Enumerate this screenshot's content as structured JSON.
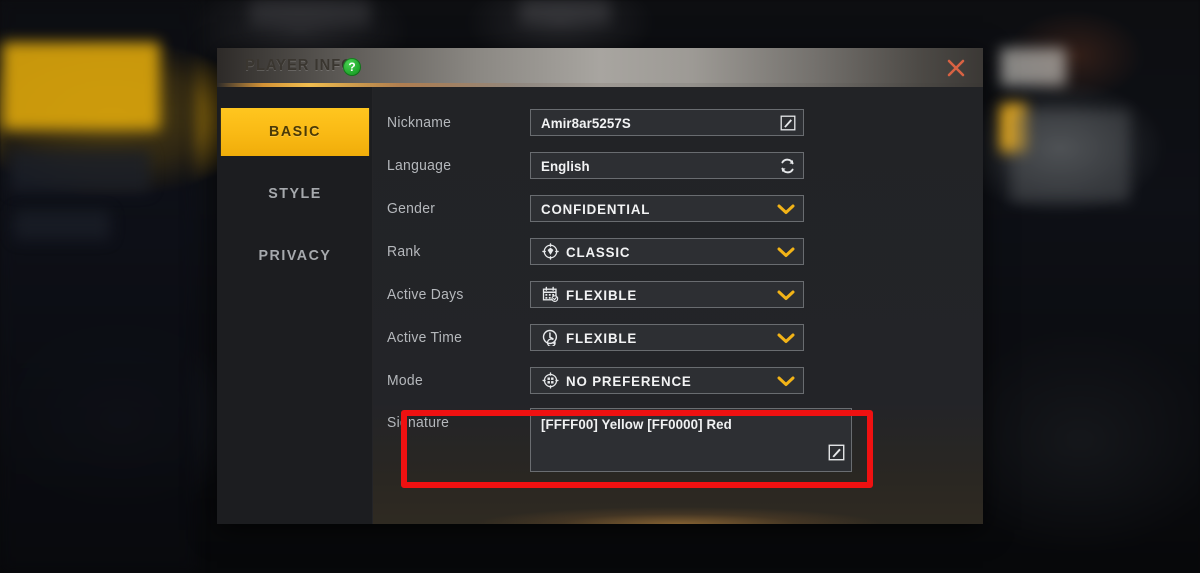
{
  "window": {
    "title": "PLAYER INFO",
    "help_icon": "help-question-icon",
    "close_icon": "close-x-icon",
    "close_color": "#d86243",
    "accent_color": "#f9b914",
    "help_color": "#22a92e"
  },
  "tabs": [
    {
      "label": "BASIC",
      "active": true
    },
    {
      "label": "STYLE",
      "active": false
    },
    {
      "label": "PRIVACY",
      "active": false
    }
  ],
  "fields": [
    {
      "label": "Nickname",
      "value": "Amir8ar5257S",
      "lead_icon": "",
      "tail_icon": "edit-pencil-icon",
      "style": "plain"
    },
    {
      "label": "Language",
      "value": "English",
      "lead_icon": "",
      "tail_icon": "refresh-icon",
      "style": "plain"
    },
    {
      "label": "Gender",
      "value": "CONFIDENTIAL",
      "lead_icon": "",
      "tail_icon": "chevron-down-icon",
      "style": "caps"
    },
    {
      "label": "Rank",
      "value": "CLASSIC",
      "lead_icon": "rank-diamond-icon",
      "tail_icon": "chevron-down-icon",
      "style": "caps"
    },
    {
      "label": "Active Days",
      "value": "FLEXIBLE",
      "lead_icon": "calendar-icon",
      "tail_icon": "chevron-down-icon",
      "style": "caps"
    },
    {
      "label": "Active Time",
      "value": "FLEXIBLE",
      "lead_icon": "clock-icon",
      "tail_icon": "chevron-down-icon",
      "style": "caps"
    },
    {
      "label": "Mode",
      "value": "NO PREFERENCE",
      "lead_icon": "mode-grid-icon",
      "tail_icon": "chevron-down-icon",
      "style": "caps"
    }
  ],
  "signature": {
    "label": "Signature",
    "value": "[FFFF00] Yellow [FF0000] Red",
    "edit_icon": "edit-pencil-icon"
  },
  "annotation": {
    "color": "#ef1111",
    "target": "signature-row"
  }
}
